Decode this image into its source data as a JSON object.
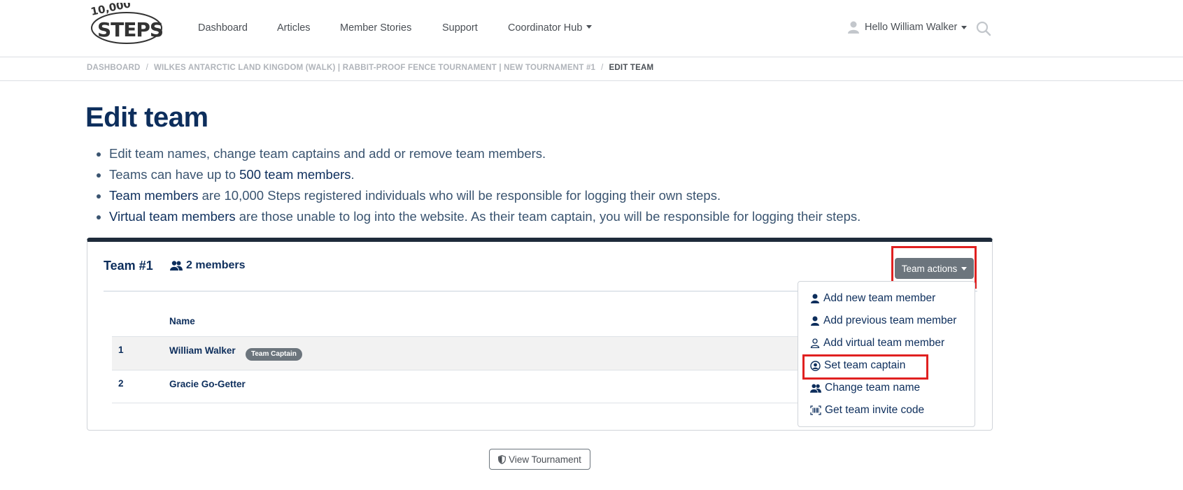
{
  "brand": {
    "logo_text": "10,000 STEPS"
  },
  "nav": {
    "items": [
      "Dashboard",
      "Articles",
      "Member Stories",
      "Support",
      "Coordinator Hub"
    ],
    "user_greeting": "Hello William Walker"
  },
  "breadcrumb": {
    "items": [
      "DASHBOARD",
      "WILKES ANTARCTIC LAND KINGDOM (WALK) | RABBIT-PROOF FENCE TOURNAMENT | NEW TOURNAMENT #1"
    ],
    "separator": "/",
    "current": "EDIT TEAM"
  },
  "page": {
    "title": "Edit team",
    "intro": [
      {
        "strong": "",
        "text": "Edit team names, change team captains and add or remove team members."
      },
      {
        "pre": "Teams can have up to ",
        "strong": "500 team members",
        "post": "."
      },
      {
        "strong": "Team members",
        "post": " are 10,000 Steps registered individuals who will be responsible for logging their own steps."
      },
      {
        "strong": "Virtual team members",
        "post": " are those unable to log into the website. As their team captain, you will be responsible for logging their steps."
      }
    ]
  },
  "team": {
    "name": "Team #1",
    "member_count": "2 members",
    "actions_label": "Team actions",
    "table": {
      "header": "Name",
      "rows": [
        {
          "index": "1",
          "name": "William Walker",
          "badge": "Team Captain"
        },
        {
          "index": "2",
          "name": "Gracie Go-Getter",
          "badge": ""
        }
      ]
    },
    "actions_menu": [
      {
        "label": "Add new team member",
        "icon": "user-icon"
      },
      {
        "label": "Add previous team member",
        "icon": "user-icon"
      },
      {
        "label": "Add virtual team member",
        "icon": "user-outline-icon"
      },
      {
        "label": "Set team captain",
        "icon": "user-circle-icon"
      },
      {
        "label": "Change team name",
        "icon": "users-icon"
      },
      {
        "label": "Get team invite code",
        "icon": "barcode-icon"
      }
    ]
  },
  "footer": {
    "view_tournament_label": "View Tournament"
  },
  "colors": {
    "heading": "#0d2e5c",
    "button_gray": "#6c757d",
    "highlight_red": "#e02020"
  }
}
